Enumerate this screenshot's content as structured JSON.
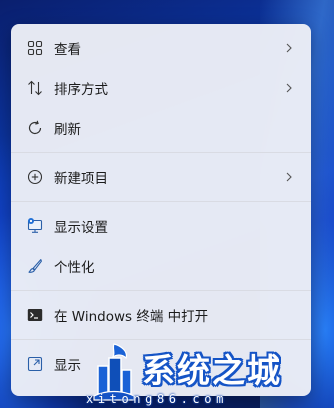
{
  "menu": {
    "items": [
      {
        "label": "查看",
        "icon": "grid-icon",
        "submenu": true
      },
      {
        "label": "排序方式",
        "icon": "sort-icon",
        "submenu": true
      },
      {
        "label": "刷新",
        "icon": "refresh-icon",
        "submenu": false
      },
      {
        "label": "新建项目",
        "icon": "add-circle-icon",
        "submenu": true
      },
      {
        "label": "显示设置",
        "icon": "display-settings-icon",
        "submenu": false
      },
      {
        "label": "个性化",
        "icon": "brush-icon",
        "submenu": false
      },
      {
        "label": "在 Windows 终端 中打开",
        "icon": "terminal-icon",
        "submenu": false
      },
      {
        "label": "显示",
        "icon": "expand-icon",
        "submenu": false
      }
    ]
  },
  "watermark": {
    "title": "系统之城",
    "url": "xitong86.com"
  },
  "colors": {
    "menu_bg": "#eceef6",
    "accent": "#1554c6",
    "text": "#1b1b1b"
  }
}
